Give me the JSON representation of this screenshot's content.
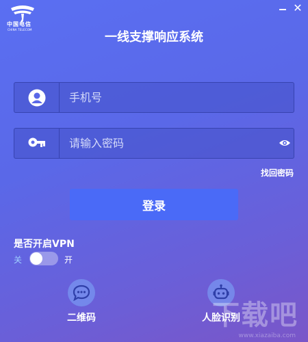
{
  "brand": {
    "name_cn": "中国电信",
    "name_en": "CHINA TELECOM"
  },
  "window": {
    "close_glyph": "✕"
  },
  "app": {
    "title": "一线支撑响应系统"
  },
  "form": {
    "phone_placeholder": "手机号",
    "password_placeholder": "请输入密码",
    "forgot_label": "找回密码",
    "login_label": "登录"
  },
  "vpn": {
    "label": "是否开启VPN",
    "off_label": "关",
    "on_label": "开",
    "enabled": false
  },
  "alt_login": {
    "qr_label": "二维码",
    "face_label": "人脸识别"
  },
  "watermark": {
    "text": "下载吧",
    "url": "www.xiazaiba.com"
  },
  "icons": [
    "china-telecom-logo",
    "minimize-icon",
    "close-icon",
    "user-icon",
    "key-icon",
    "eye-icon",
    "chat-bubble-icon",
    "robot-icon"
  ],
  "colors": {
    "accent": "#4a6af7",
    "background": "#5a68e8"
  }
}
